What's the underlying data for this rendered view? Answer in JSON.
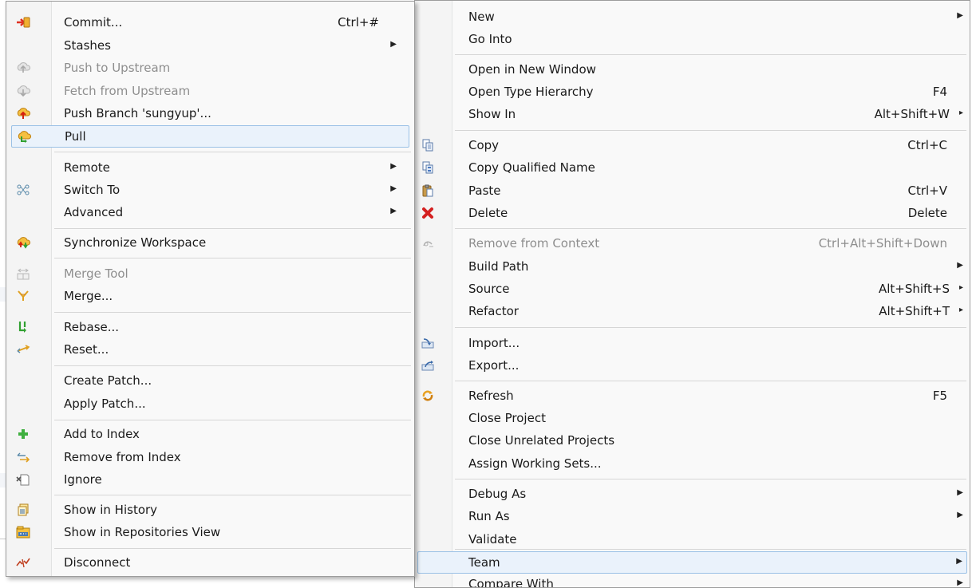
{
  "main_menu": {
    "items": [
      {
        "label": "New",
        "shortcut": "",
        "arrow": true
      },
      {
        "label": "Go Into",
        "shortcut": "",
        "arrow": false
      },
      {
        "label": "Open in New Window",
        "shortcut": "",
        "arrow": false
      },
      {
        "label": "Open Type Hierarchy",
        "shortcut": "F4",
        "arrow": false
      },
      {
        "label": "Show In",
        "shortcut": "Alt+Shift+W",
        "arrow": true
      },
      {
        "label": "Copy",
        "shortcut": "Ctrl+C",
        "arrow": false,
        "icon": "copy-icon"
      },
      {
        "label": "Copy Qualified Name",
        "shortcut": "",
        "arrow": false,
        "icon": "copy-qualified-name-icon"
      },
      {
        "label": "Paste",
        "shortcut": "Ctrl+V",
        "arrow": false,
        "icon": "paste-icon"
      },
      {
        "label": "Delete",
        "shortcut": "Delete",
        "arrow": false,
        "icon": "delete-icon"
      },
      {
        "label": "Remove from Context",
        "shortcut": "Ctrl+Alt+Shift+Down",
        "arrow": false,
        "disabled": true,
        "icon": "remove-from-context-icon"
      },
      {
        "label": "Build Path",
        "shortcut": "",
        "arrow": true
      },
      {
        "label": "Source",
        "shortcut": "Alt+Shift+S",
        "arrow": true
      },
      {
        "label": "Refactor",
        "shortcut": "Alt+Shift+T",
        "arrow": true
      },
      {
        "label": "Import...",
        "shortcut": "",
        "arrow": false,
        "icon": "import-icon"
      },
      {
        "label": "Export...",
        "shortcut": "",
        "arrow": false,
        "icon": "export-icon"
      },
      {
        "label": "Refresh",
        "shortcut": "F5",
        "arrow": false,
        "icon": "refresh-icon"
      },
      {
        "label": "Close Project",
        "shortcut": "",
        "arrow": false
      },
      {
        "label": "Close Unrelated Projects",
        "shortcut": "",
        "arrow": false
      },
      {
        "label": "Assign Working Sets...",
        "shortcut": "",
        "arrow": false
      },
      {
        "label": "Debug As",
        "shortcut": "",
        "arrow": true
      },
      {
        "label": "Run As",
        "shortcut": "",
        "arrow": true
      },
      {
        "label": "Validate",
        "shortcut": "",
        "arrow": false
      },
      {
        "label": "Team",
        "shortcut": "",
        "arrow": true,
        "highlighted": true
      },
      {
        "label": "Compare With",
        "shortcut": "",
        "arrow": true
      }
    ],
    "arrow_glyph": "▸",
    "submenu_arrow_glyph": "▶"
  },
  "team_menu": {
    "items": [
      {
        "label": "Commit...",
        "shortcut": "Ctrl+#",
        "arrow": false,
        "icon": "commit-icon"
      },
      {
        "label": "Stashes",
        "shortcut": "",
        "arrow": true
      },
      {
        "label": "Push to Upstream",
        "shortcut": "",
        "arrow": false,
        "disabled": true,
        "icon": "push-upstream-icon"
      },
      {
        "label": "Fetch from Upstream",
        "shortcut": "",
        "arrow": false,
        "disabled": true,
        "icon": "fetch-upstream-icon"
      },
      {
        "label": "Push Branch 'sungyup'...",
        "shortcut": "",
        "arrow": false,
        "icon": "push-branch-icon"
      },
      {
        "label": "Pull",
        "shortcut": "",
        "arrow": false,
        "highlighted": true,
        "icon": "pull-icon"
      },
      {
        "label": "Remote",
        "shortcut": "",
        "arrow": true
      },
      {
        "label": "Switch To",
        "shortcut": "",
        "arrow": true,
        "icon": "switch-to-icon"
      },
      {
        "label": "Advanced",
        "shortcut": "",
        "arrow": true
      },
      {
        "label": "Synchronize Workspace",
        "shortcut": "",
        "arrow": false,
        "icon": "synchronize-icon"
      },
      {
        "label": "Merge Tool",
        "shortcut": "",
        "arrow": false,
        "disabled": true,
        "icon": "merge-tool-icon"
      },
      {
        "label": "Merge...",
        "shortcut": "",
        "arrow": false,
        "icon": "merge-icon"
      },
      {
        "label": "Rebase...",
        "shortcut": "",
        "arrow": false,
        "icon": "rebase-icon"
      },
      {
        "label": "Reset...",
        "shortcut": "",
        "arrow": false,
        "icon": "reset-icon"
      },
      {
        "label": "Create Patch...",
        "shortcut": "",
        "arrow": false
      },
      {
        "label": "Apply Patch...",
        "shortcut": "",
        "arrow": false
      },
      {
        "label": "Add to Index",
        "shortcut": "",
        "arrow": false,
        "icon": "add-to-index-icon"
      },
      {
        "label": "Remove from Index",
        "shortcut": "",
        "arrow": false,
        "icon": "remove-from-index-icon"
      },
      {
        "label": "Ignore",
        "shortcut": "",
        "arrow": false,
        "icon": "ignore-icon"
      },
      {
        "label": "Show in History",
        "shortcut": "",
        "arrow": false,
        "icon": "history-icon"
      },
      {
        "label": "Show in Repositories View",
        "shortcut": "",
        "arrow": false,
        "icon": "repositories-view-icon"
      },
      {
        "label": "Disconnect",
        "shortcut": "",
        "arrow": false,
        "icon": "disconnect-icon"
      }
    ]
  }
}
